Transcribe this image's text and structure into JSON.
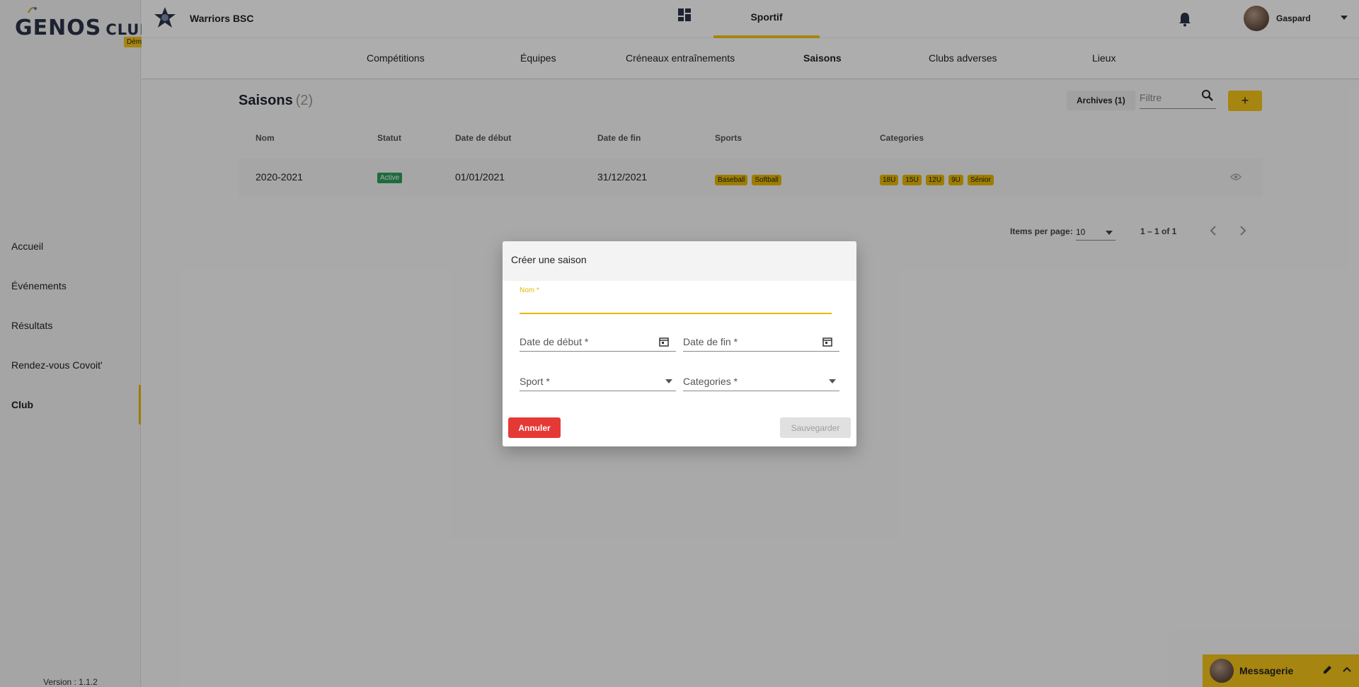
{
  "app": {
    "logo_main": "GENOS",
    "logo_sub": "CLUBS",
    "logo_badge": "Démo",
    "version": "Version : 1.1.2"
  },
  "sidebar": {
    "items": [
      {
        "label": "Accueil",
        "icon": "none"
      },
      {
        "label": "Événements",
        "icon": "none"
      },
      {
        "label": "Résultats",
        "icon": "none"
      },
      {
        "label": "Rendez-vous Covoit'",
        "icon": "none"
      },
      {
        "label": "Club",
        "icon": "none",
        "active": true
      }
    ]
  },
  "topbar": {
    "club_name": "Warriors BSC",
    "active_tab": "Sportif",
    "user_name": "Gaspard"
  },
  "subnav": {
    "items": [
      "Compétitions",
      "Équipes",
      "Créneaux entraînements",
      "Saisons",
      "Clubs adverses",
      "Lieux"
    ],
    "active": "Saisons"
  },
  "page": {
    "title": "Saisons",
    "count": "(2)",
    "archives_label": "Archives (1)",
    "filter_placeholder": "Filtre",
    "add_label": "+"
  },
  "table": {
    "headers": {
      "name": "Nom",
      "status": "Statut",
      "start": "Date de début",
      "end": "Date de fin",
      "sports": "Sports",
      "categories": "Categories"
    },
    "rows": [
      {
        "name": "2020-2021",
        "status": "Active",
        "start": "01/01/2021",
        "end": "31/12/2021",
        "sports": [
          "Baseball",
          "Softball"
        ],
        "categories": [
          "18U",
          "15U",
          "12U",
          "9U",
          "Sénior"
        ]
      }
    ]
  },
  "paginator": {
    "items_per_page_label": "Items per page:",
    "page_size": "10",
    "range": "1 – 1 of 1"
  },
  "dialog": {
    "title": "Créer une saison",
    "nom_label": "Nom",
    "required_mark": "*",
    "date_start_label": "Date de début *",
    "date_end_label": "Date de fin *",
    "sport_label": "Sport *",
    "categories_label": "Categories *",
    "cancel_label": "Annuler",
    "save_label": "Sauvegarder"
  },
  "messenger": {
    "label": "Messagerie"
  },
  "colors": {
    "accent": "#f5c518",
    "chip": "#e6b800",
    "status_active": "#2e9e5b",
    "cancel": "#e53935",
    "brand_text": "#2c3347"
  }
}
